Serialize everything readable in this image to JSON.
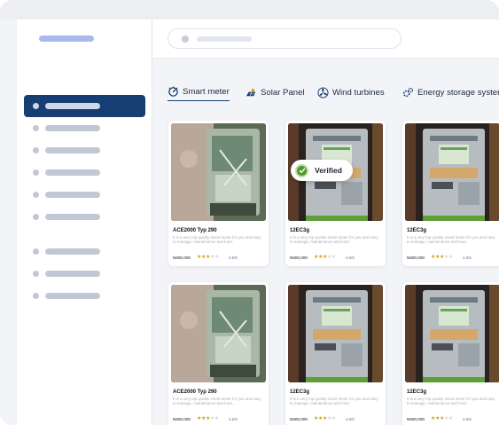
{
  "tabs": [
    {
      "label": "Smart meter",
      "icon": "meter-icon",
      "active": true
    },
    {
      "label": "Solar Panel",
      "icon": "solar-panel-icon",
      "active": false
    },
    {
      "label": "Wind turbines",
      "icon": "wind-turbine-icon",
      "active": false
    },
    {
      "label": "Energy storage syster",
      "icon": "energy-storage-icon",
      "active": false
    }
  ],
  "badge": {
    "label": "Verified",
    "icon": "check-icon"
  },
  "products": [
    {
      "title": "ACE2000 Typ 290",
      "desc": "It is a very top quality smart meter for you and easy to manage, maintenance and fund.",
      "price": "N600,000",
      "rating": "4.5/5",
      "stars": 3.5
    },
    {
      "title": "12EC3g",
      "desc": "It is a very top quality smart meter for you and easy to manage, maintenance and fund.",
      "price": "N600,000",
      "rating": "4.5/5",
      "stars": 3.5
    },
    {
      "title": "12EC3g",
      "desc": "It is a very top quality smart meter for you and easy to manage, maintenance and fund.",
      "price": "N600,000",
      "rating": "4.5/5",
      "stars": 3.5
    },
    {
      "title": "ACE2000 Typ 290",
      "desc": "It is a very top quality smart meter for you and easy to manage, maintenance and fund.",
      "price": "N600,000",
      "rating": "4.5/5",
      "stars": 3.5
    },
    {
      "title": "12EC3g",
      "desc": "It is a very top quality smart meter for you and easy to manage, maintenance and fund.",
      "price": "N600,000",
      "rating": "4.5/5",
      "stars": 3.5
    },
    {
      "title": "12EC3g",
      "desc": "It is a very top quality smart meter for you and easy to manage, maintenance and fund.",
      "price": "N600,000",
      "rating": "4.5/5",
      "stars": 3.5
    }
  ],
  "colors": {
    "primary": "#173e72",
    "accent": "#a9b9ee",
    "star": "#d9a21b",
    "verified": "#4c9a2a"
  }
}
